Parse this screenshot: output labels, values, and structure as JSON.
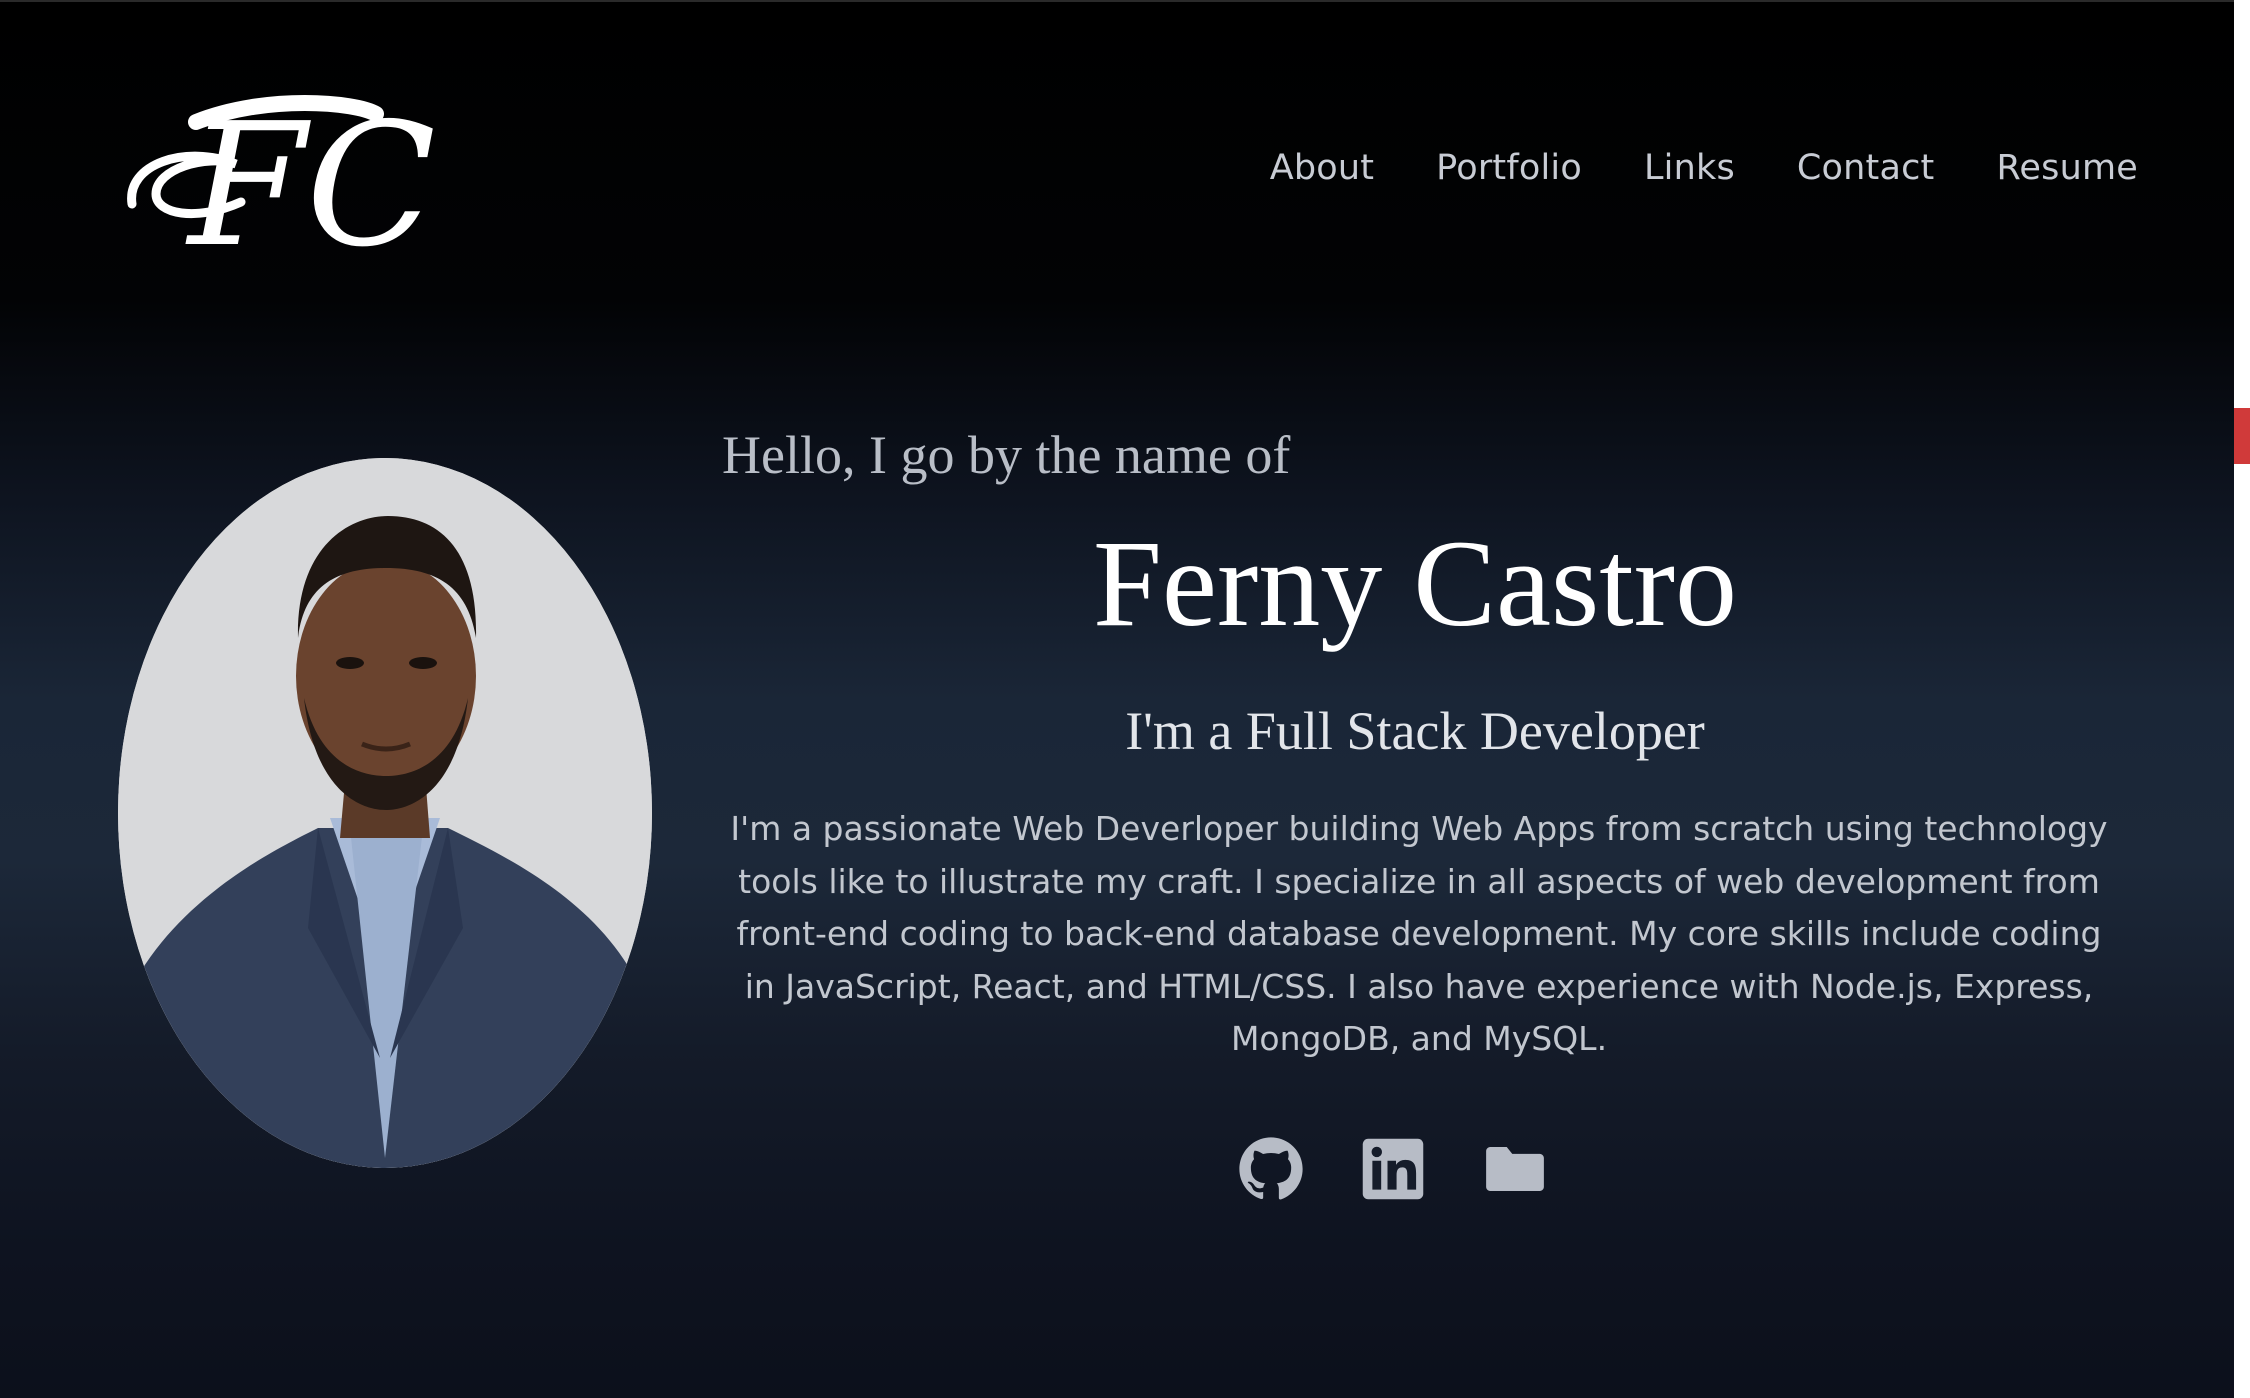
{
  "logo": {
    "text": "FC"
  },
  "nav": {
    "items": [
      {
        "label": "About"
      },
      {
        "label": "Portfolio"
      },
      {
        "label": "Links"
      },
      {
        "label": "Contact"
      },
      {
        "label": "Resume"
      }
    ]
  },
  "hero": {
    "greeting": "Hello, I go by the name of",
    "name": "Ferny Castro",
    "role": "I'm a Full Stack Developer",
    "bio": "I'm a passionate Web Deverloper building Web Apps from scratch using technology tools like to illustrate my craft. I specialize in all aspects of web development from front-end coding to back-end database development. My core skills include coding in JavaScript, React, and HTML/CSS. I also have experience with Node.js, Express, MongoDB, and MySQL."
  },
  "socials": [
    {
      "icon": "github-icon"
    },
    {
      "icon": "linkedin-icon"
    },
    {
      "icon": "folder-icon"
    }
  ],
  "colors": {
    "text_primary": "#ffffff",
    "text_muted": "#c2c7cf",
    "icon": "#b7bcc6"
  }
}
